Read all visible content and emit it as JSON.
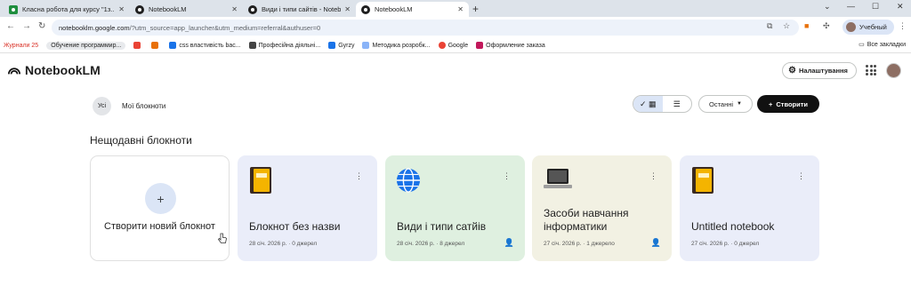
{
  "browser": {
    "tabs": [
      {
        "label": "Класна робота для курсу \"1з...",
        "active": false
      },
      {
        "label": "NotebookLM",
        "active": false
      },
      {
        "label": "Види і типи сайтів - Notebook...",
        "active": false
      },
      {
        "label": "NotebookLM",
        "active": true
      }
    ],
    "url_domain": "notebooklm.google.com",
    "url_path": "/?utm_source=app_launcher&utm_medium=referral&authuser=0",
    "profile_label": "Учебный",
    "bookmarks": [
      {
        "label": "Журнали 25",
        "color": "#d93025"
      },
      {
        "label": "Обучение программир...",
        "color": "#9aa0a6"
      },
      {
        "label": "",
        "color": "#ea4335"
      },
      {
        "label": "",
        "color": "#e8710a"
      },
      {
        "label": "css властивість bac...",
        "color": "#1a73e8"
      },
      {
        "label": "Професійна діяльні...",
        "color": "#444"
      },
      {
        "label": "Gyrzy",
        "color": "#1a73e8"
      },
      {
        "label": "Методика розробк...",
        "color": "#1a73e8"
      },
      {
        "label": "Google",
        "color": "#ea4335"
      },
      {
        "label": "Оформление заказа",
        "color": "#c2185b"
      }
    ],
    "all_bookmarks": "Все закладки"
  },
  "app": {
    "name": "NotebookLM",
    "settings_label": "Налаштування",
    "workspace_badge": "Усі",
    "workspace_label": "Мої блокноти",
    "sort_label": "Останні",
    "create_label": "Створити",
    "section_title": "Нещодавні блокноти",
    "new_notebook_label": "Створити новий блокнот",
    "notebooks": [
      {
        "title": "Блокнот без назви",
        "meta": "28 січ. 2026 р. · 0 джерел",
        "icon": "notebook-icon",
        "bg": "#eaedf9",
        "shared": false
      },
      {
        "title": "Види і типи сатйів",
        "meta": "28 січ. 2026 р. · 8 джерел",
        "icon": "globe-icon",
        "bg": "#dff0e0",
        "shared": true
      },
      {
        "title": "Засоби навчання інформатики",
        "meta": "27 січ. 2026 р. · 1 джерело",
        "icon": "laptop-icon",
        "bg": "#f2f1e3",
        "shared": true
      },
      {
        "title": "Untitled notebook",
        "meta": "27 січ. 2026 р. · 0 джерел",
        "icon": "notebook-icon",
        "bg": "#eaedf9",
        "shared": false
      }
    ]
  }
}
